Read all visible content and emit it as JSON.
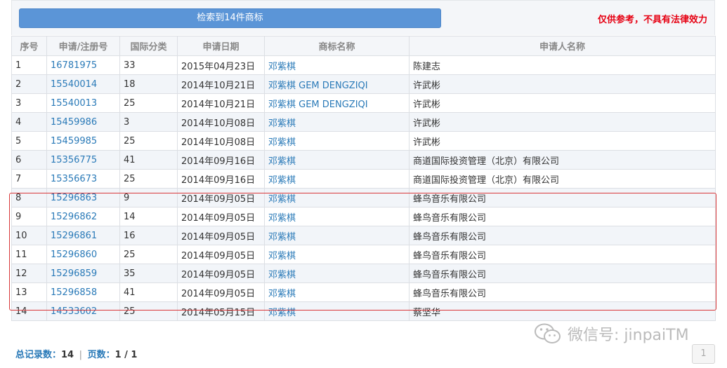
{
  "header": {
    "search_button_label": "检索到14件商标",
    "disclaimer": "仅供参考，不具有法律效力"
  },
  "table": {
    "columns": [
      "序号",
      "申请/注册号",
      "国际分类",
      "申请日期",
      "商标名称",
      "申请人名称"
    ],
    "rows": [
      [
        "1",
        "16781975",
        "33",
        "2015年04月23日",
        "邓紫棋",
        "陈建志"
      ],
      [
        "2",
        "15540014",
        "18",
        "2014年10月21日",
        "邓紫棋 GEM DENGZIQI",
        "许武彬"
      ],
      [
        "3",
        "15540013",
        "25",
        "2014年10月21日",
        "邓紫棋 GEM DENGZIQI",
        "许武彬"
      ],
      [
        "4",
        "15459986",
        "3",
        "2014年10月08日",
        "邓紫棋",
        "许武彬"
      ],
      [
        "5",
        "15459985",
        "25",
        "2014年10月08日",
        "邓紫棋",
        "许武彬"
      ],
      [
        "6",
        "15356775",
        "41",
        "2014年09月16日",
        "邓紫棋",
        "商道国际投资管理（北京）有限公司"
      ],
      [
        "7",
        "15356673",
        "25",
        "2014年09月16日",
        "邓紫棋",
        "商道国际投资管理（北京）有限公司"
      ],
      [
        "8",
        "15296863",
        "9",
        "2014年09月05日",
        "邓紫棋",
        "蜂鸟音乐有限公司"
      ],
      [
        "9",
        "15296862",
        "14",
        "2014年09月05日",
        "邓紫棋",
        "蜂鸟音乐有限公司"
      ],
      [
        "10",
        "15296861",
        "16",
        "2014年09月05日",
        "邓紫棋",
        "蜂鸟音乐有限公司"
      ],
      [
        "11",
        "15296860",
        "25",
        "2014年09月05日",
        "邓紫棋",
        "蜂鸟音乐有限公司"
      ],
      [
        "12",
        "15296859",
        "35",
        "2014年09月05日",
        "邓紫棋",
        "蜂鸟音乐有限公司"
      ],
      [
        "13",
        "15296858",
        "41",
        "2014年09月05日",
        "邓紫棋",
        "蜂鸟音乐有限公司"
      ],
      [
        "14",
        "14533602",
        "25",
        "2014年05月15日",
        "邓紫棋",
        "蔡坚华"
      ]
    ]
  },
  "footer": {
    "total_label": "总记录数：",
    "total_value": "14",
    "separator": "|",
    "pages_label": "页数：",
    "pages_value": "1 / 1"
  },
  "pagination": {
    "current_page": "1"
  },
  "watermark": {
    "text": "微信号: jinpaiTM",
    "icon": "wechat-icon"
  }
}
